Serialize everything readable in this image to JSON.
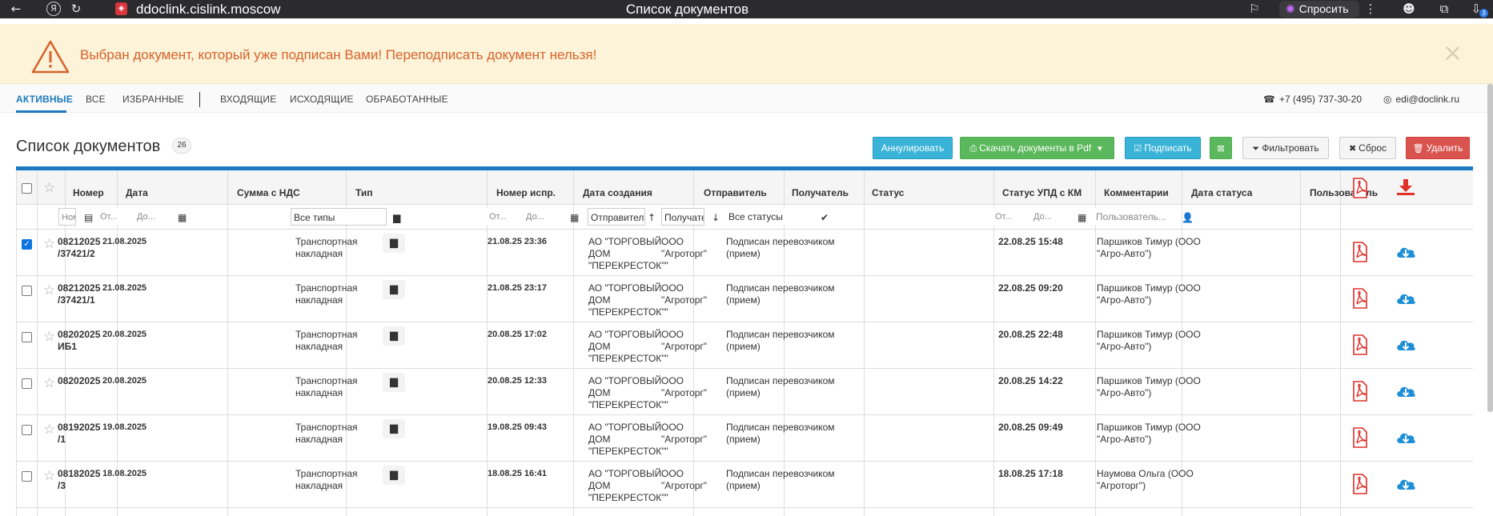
{
  "browser": {
    "url": "ddoclink.cislink.moscow",
    "title": "Список документов",
    "ask_label": "Спросить",
    "notification_count": "3"
  },
  "alert": {
    "message": "Выбран документ, который уже подписан Вами! Переподписать документ нельзя!"
  },
  "tabs": [
    "АКТИВНЫЕ",
    "ВСЕ",
    "ИЗБРАННЫЕ",
    "ВХОДЯЩИЕ",
    "ИСХОДЯЩИЕ",
    "ОБРАБОТАННЫЕ"
  ],
  "contacts": {
    "phone": "+7 (495) 737-30-20",
    "email": "edi@doclink.ru"
  },
  "page": {
    "title": "Список документов",
    "count": "26"
  },
  "toolbar": {
    "annul": "Аннулировать",
    "download_pdf": "Скачать документы в Pdf",
    "sign": "Подписать",
    "filter": "Фильтровать",
    "reset": "Сброс",
    "delete": "Удалить"
  },
  "columns": {
    "number": "Номер",
    "date": "Дата",
    "sum_vat": "Сумма с НДС",
    "type": "Тип",
    "fix_number": "Номер испр.",
    "created": "Дата создания",
    "sender": "Отправитель",
    "receiver": "Получатель",
    "status": "Статус",
    "upd_status": "Статус УПД с КМ",
    "comments": "Комментарии",
    "status_date": "Дата статуса",
    "user": "Пользователь"
  },
  "filters": {
    "number_ph": "Ном",
    "date_from": "От...",
    "date_to": "До...",
    "type_value": "Все типы",
    "created_from": "От...",
    "created_to": "До...",
    "sender_ph": "Отправитель",
    "receiver_ph": "Получатель",
    "status_value": "Все статусы",
    "status_date_from": "От...",
    "status_date_to": "До...",
    "user_ph": "Пользователь..."
  },
  "rows": [
    {
      "number": [
        "08212025",
        "/37421/2"
      ],
      "date": "21.08.2025",
      "type": [
        "Транспортная",
        "накладная"
      ],
      "created": "21.08.25 23:36",
      "sender": [
        "АО \"ТОРГОВЫЙ",
        "ДОМ",
        "\"ПЕРЕКРЕСТОК\"\""
      ],
      "receiver": [
        "ООО",
        "\"Агроторг\""
      ],
      "status": [
        "Подписан перевозчиком",
        "(прием)"
      ],
      "status_date": "22.08.25 15:48",
      "user": [
        "Паршиков Тимур (ООО",
        "\"Агро-Авто\")"
      ],
      "checked": true
    },
    {
      "number": [
        "08212025",
        "/37421/1"
      ],
      "date": "21.08.2025",
      "type": [
        "Транспортная",
        "накладная"
      ],
      "created": "21.08.25 23:17",
      "sender": [
        "АО \"ТОРГОВЫЙ",
        "ДОМ",
        "\"ПЕРЕКРЕСТОК\"\""
      ],
      "receiver": [
        "ООО",
        "\"Агроторг\""
      ],
      "status": [
        "Подписан перевозчиком",
        "(прием)"
      ],
      "status_date": "22.08.25 09:20",
      "user": [
        "Паршиков Тимур (ООО",
        "\"Агро-Авто\")"
      ],
      "checked": false
    },
    {
      "number": [
        "08202025",
        "ИБ1"
      ],
      "date": "20.08.2025",
      "type": [
        "Транспортная",
        "накладная"
      ],
      "created": "20.08.25 17:02",
      "sender": [
        "АО \"ТОРГОВЫЙ",
        "ДОМ",
        "\"ПЕРЕКРЕСТОК\"\""
      ],
      "receiver": [
        "ООО",
        "\"Агроторг\""
      ],
      "status": [
        "Подписан перевозчиком",
        "(прием)"
      ],
      "status_date": "20.08.25 22:48",
      "user": [
        "Паршиков Тимур (ООО",
        "\"Агро-Авто\")"
      ],
      "checked": false
    },
    {
      "number": [
        "08202025",
        ""
      ],
      "date": "20.08.2025",
      "type": [
        "Транспортная",
        "накладная"
      ],
      "created": "20.08.25 12:33",
      "sender": [
        "АО \"ТОРГОВЫЙ",
        "ДОМ",
        "\"ПЕРЕКРЕСТОК\"\""
      ],
      "receiver": [
        "ООО",
        "\"Агроторг\""
      ],
      "status": [
        "Подписан перевозчиком",
        "(прием)"
      ],
      "status_date": "20.08.25 14:22",
      "user": [
        "Паршиков Тимур (ООО",
        "\"Агро-Авто\")"
      ],
      "checked": false
    },
    {
      "number": [
        "08192025",
        "/1"
      ],
      "date": "19.08.2025",
      "type": [
        "Транспортная",
        "накладная"
      ],
      "created": "19.08.25 09:43",
      "sender": [
        "АО \"ТОРГОВЫЙ",
        "ДОМ",
        "\"ПЕРЕКРЕСТОК\"\""
      ],
      "receiver": [
        "ООО",
        "\"Агроторг\""
      ],
      "status": [
        "Подписан перевозчиком",
        "(прием)"
      ],
      "status_date": "20.08.25 09:49",
      "user": [
        "Паршиков Тимур (ООО",
        "\"Агро-Авто\")"
      ],
      "checked": false
    },
    {
      "number": [
        "08182025",
        "/3"
      ],
      "date": "18.08.2025",
      "type": [
        "Транспортная",
        "накладная"
      ],
      "created": "18.08.25 16:41",
      "sender": [
        "АО \"ТОРГОВЫЙ",
        "ДОМ",
        "\"ПЕРЕКРЕСТОК\"\""
      ],
      "receiver": [
        "ООО",
        "\"Агроторг\""
      ],
      "status": [
        "Подписан перевозчиком",
        "(прием)"
      ],
      "status_date": "18.08.25 17:18",
      "user": [
        "Наумова Ольга (ООО",
        "\"Агроторг\")"
      ],
      "checked": false
    }
  ]
}
